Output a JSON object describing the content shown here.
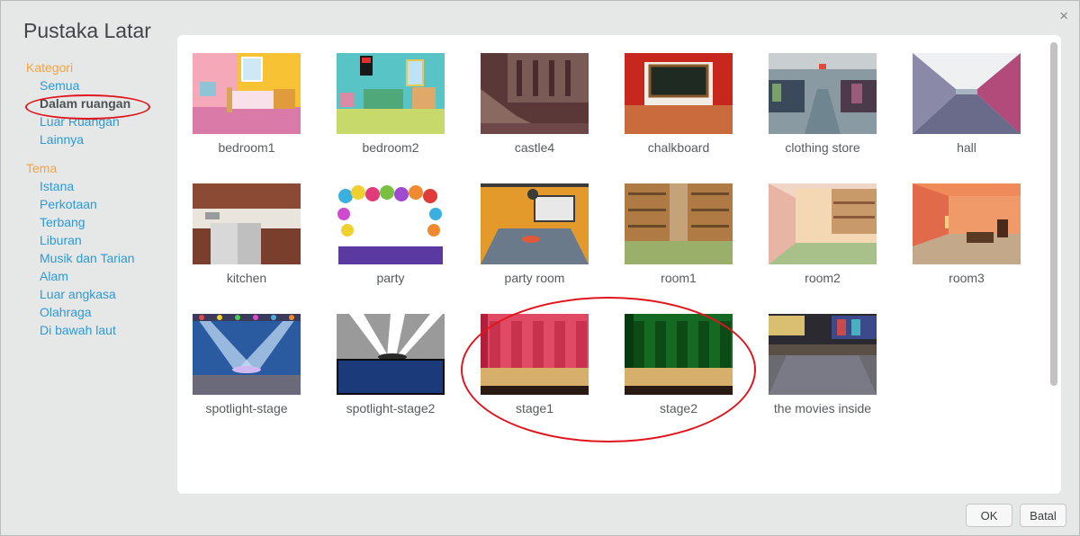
{
  "dialog": {
    "title": "Pustaka Latar",
    "close_glyph": "×"
  },
  "sidebar": {
    "category_heading": "Kategori",
    "categories": [
      {
        "label": "Semua"
      },
      {
        "label": "Dalam ruangan",
        "selected": true
      },
      {
        "label": "Luar Ruangan"
      },
      {
        "label": "Lainnya"
      }
    ],
    "theme_heading": "Tema",
    "themes": [
      {
        "label": "Istana"
      },
      {
        "label": "Perkotaan"
      },
      {
        "label": "Terbang"
      },
      {
        "label": "Liburan"
      },
      {
        "label": "Musik dan Tarian"
      },
      {
        "label": "Alam"
      },
      {
        "label": "Luar angkasa"
      },
      {
        "label": "Olahraga"
      },
      {
        "label": "Di bawah laut"
      }
    ]
  },
  "backdrops": [
    {
      "label": "bedroom1"
    },
    {
      "label": "bedroom2"
    },
    {
      "label": "castle4"
    },
    {
      "label": "chalkboard"
    },
    {
      "label": "clothing store"
    },
    {
      "label": "hall"
    },
    {
      "label": "kitchen"
    },
    {
      "label": "party"
    },
    {
      "label": "party room"
    },
    {
      "label": "room1"
    },
    {
      "label": "room2"
    },
    {
      "label": "room3"
    },
    {
      "label": "spotlight-stage"
    },
    {
      "label": "spotlight-stage2"
    },
    {
      "label": "stage1"
    },
    {
      "label": "stage2"
    },
    {
      "label": "the movies inside"
    }
  ],
  "buttons": {
    "ok": "OK",
    "cancel": "Batal"
  },
  "colors": {
    "accent": "#2d99d6",
    "heading": "#f7a23a",
    "annotation": "#e0161d"
  }
}
